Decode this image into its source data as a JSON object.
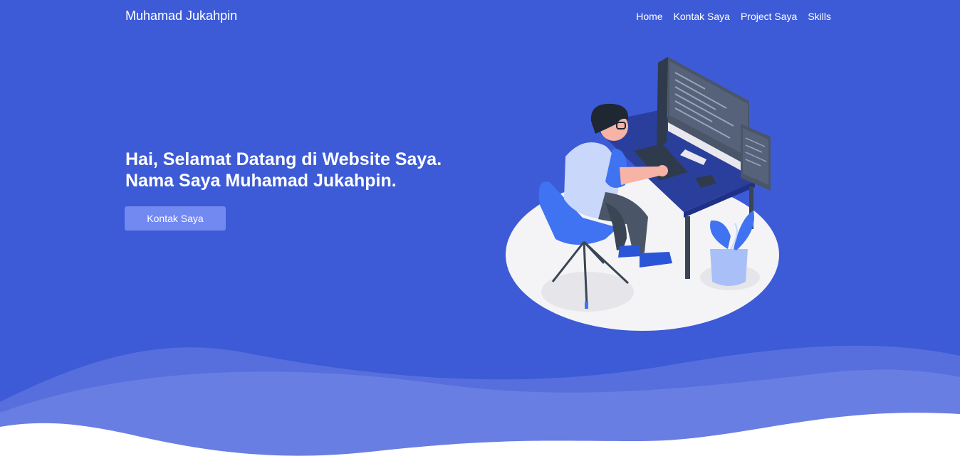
{
  "navbar": {
    "brand": "Muhamad Jukahpin",
    "links": [
      "Home",
      "Kontak Saya",
      "Project Saya",
      "Skills"
    ]
  },
  "hero": {
    "title_line1": "Hai, Selamat Datang di Website Saya.",
    "title_line2": "Nama Saya Muhamad Jukahpin.",
    "button_label": "Kontak Saya"
  },
  "colors": {
    "background": "#3d5bd6",
    "button": "#7289f2",
    "wave_light": "#6a80e2",
    "wave_front": "#ffffff"
  },
  "illustration": {
    "icon": "developer-at-desk-illustration"
  }
}
